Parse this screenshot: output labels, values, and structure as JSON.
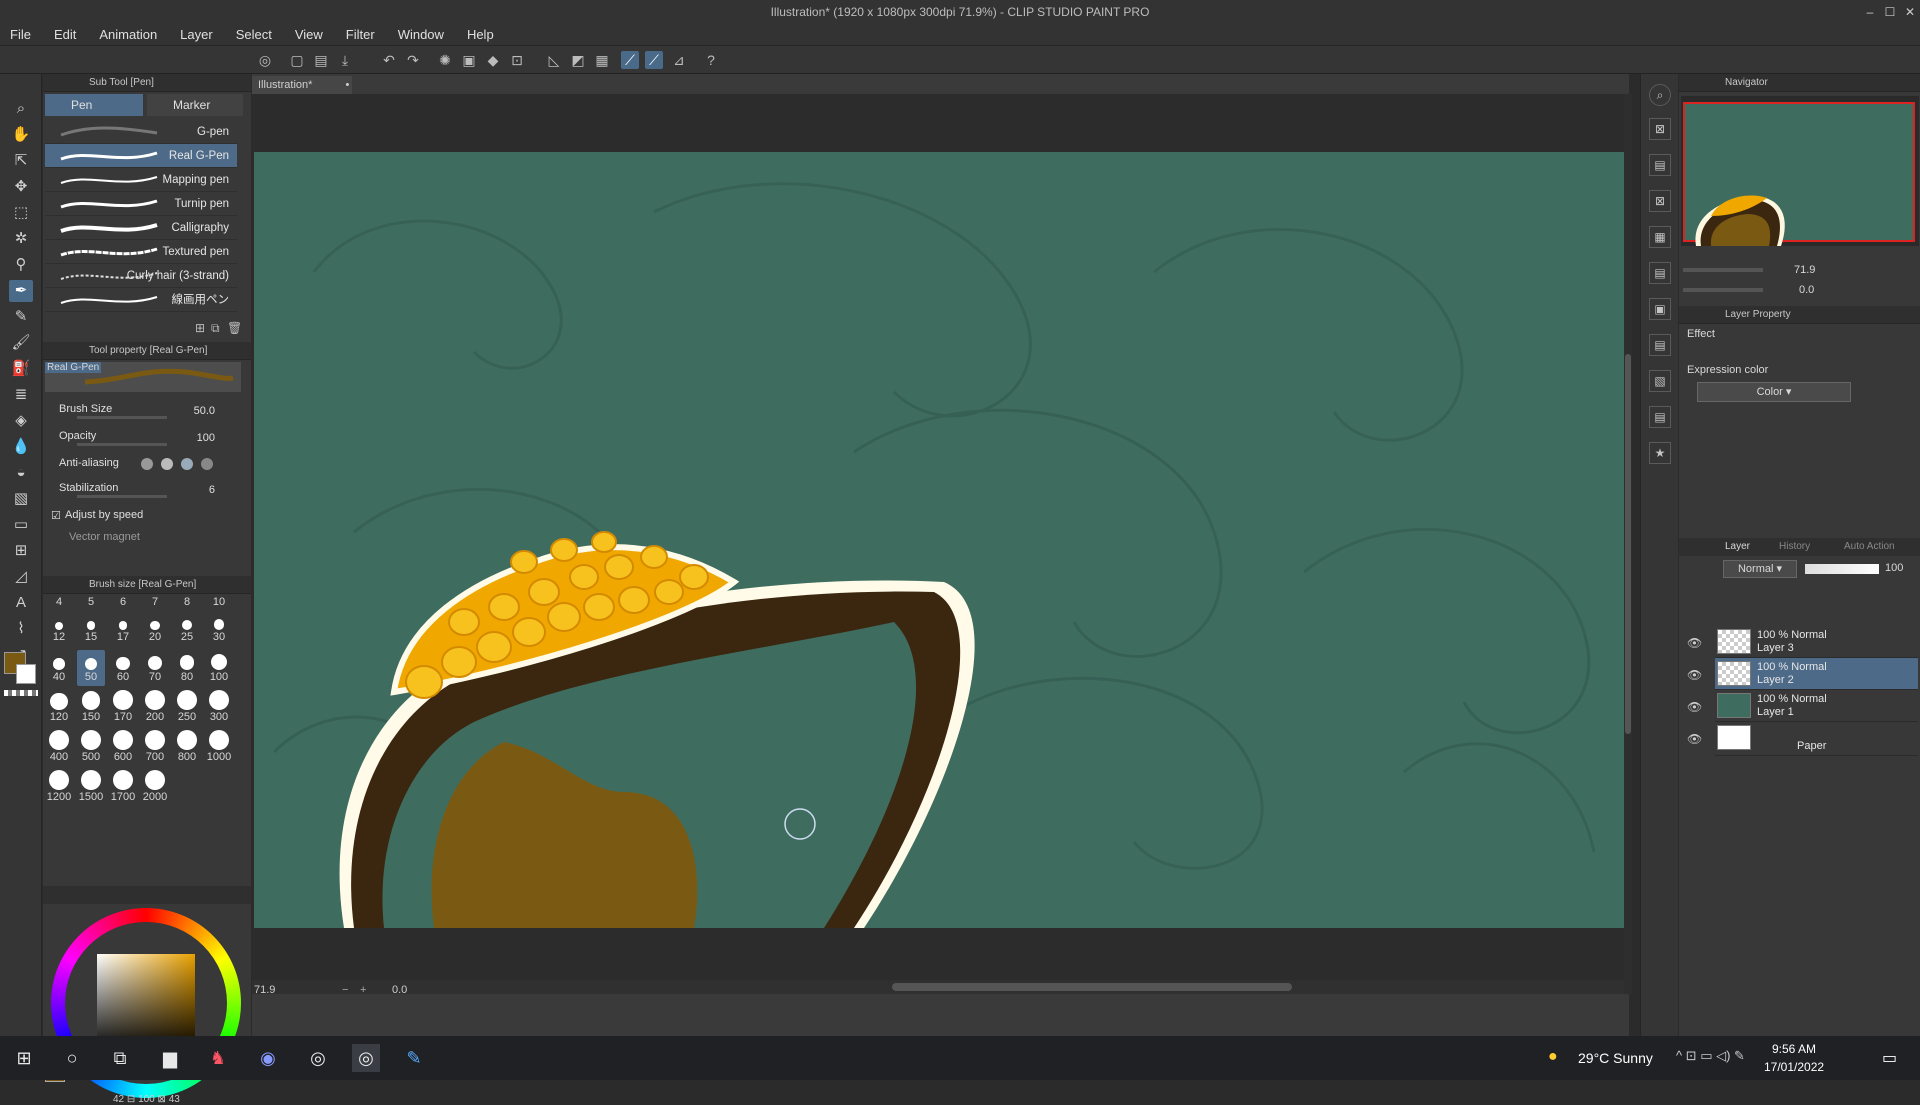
{
  "window": {
    "title": "Illustration* (1920 x 1080px 300dpi 71.9%) - CLIP STUDIO PAINT PRO",
    "minimize": "–",
    "maximize": "☐",
    "close": "✕"
  },
  "menu": [
    "File",
    "Edit",
    "Animation",
    "Layer",
    "Select",
    "View",
    "Filter",
    "Window",
    "Help"
  ],
  "subtool": {
    "header": "Sub Tool [Pen]",
    "tab_pen": "Pen",
    "tab_marker": "Marker",
    "brushes": [
      "G-pen",
      "Real G-Pen",
      "Mapping pen",
      "Turnip pen",
      "Calligraphy",
      "Textured pen",
      "Curly hair (3-strand)",
      "線画用ペン"
    ],
    "selected": "Real G-Pen"
  },
  "toolprop": {
    "header": "Tool property [Real G-Pen]",
    "preview_label": "Real G-Pen",
    "brush_size_label": "Brush Size",
    "brush_size": "50.0",
    "opacity_label": "Opacity",
    "opacity": "100",
    "anti_label": "Anti-aliasing",
    "stab_label": "Stabilization",
    "stab": "6",
    "adjust_label": "Adjust by speed",
    "vector_label": "Vector magnet"
  },
  "brushsize": {
    "header": "Brush size [Real G-Pen]",
    "top_row": [
      "4",
      "5",
      "6",
      "7",
      "8",
      "10"
    ],
    "sizes": [
      "12",
      "15",
      "17",
      "20",
      "25",
      "30",
      "40",
      "50",
      "60",
      "70",
      "80",
      "100",
      "120",
      "150",
      "170",
      "200",
      "250",
      "300",
      "400",
      "500",
      "600",
      "700",
      "800",
      "1000",
      "1200",
      "1500",
      "1700",
      "2000"
    ],
    "selected": "50"
  },
  "color": {
    "main": "#7a5a12",
    "bottom_values": [
      "42",
      "100",
      "43"
    ]
  },
  "canvas": {
    "tab": "Illustration*",
    "zoom": "71.9",
    "rotate": "0.0"
  },
  "navigator": {
    "header": "Navigator",
    "zoom": "71.9",
    "rotate": "0.0"
  },
  "layerprop": {
    "header": "Layer Property",
    "effect_label": "Effect",
    "expr_label": "Expression color",
    "expr_value": "Color"
  },
  "layerpanel": {
    "tab_layer": "Layer",
    "tab_history": "History",
    "tab_auto": "Auto Action",
    "blend": "Normal",
    "opacity": "100",
    "layers": [
      {
        "line1": "100 % Normal",
        "line2": "Layer 3"
      },
      {
        "line1": "100 % Normal",
        "line2": "Layer 2"
      },
      {
        "line1": "100 % Normal",
        "line2": "Layer 1"
      },
      {
        "line1": "",
        "line2": "Paper"
      }
    ]
  },
  "taskbar": {
    "weather": "29°C  Sunny",
    "time": "9:56 AM",
    "date": "17/01/2022"
  }
}
